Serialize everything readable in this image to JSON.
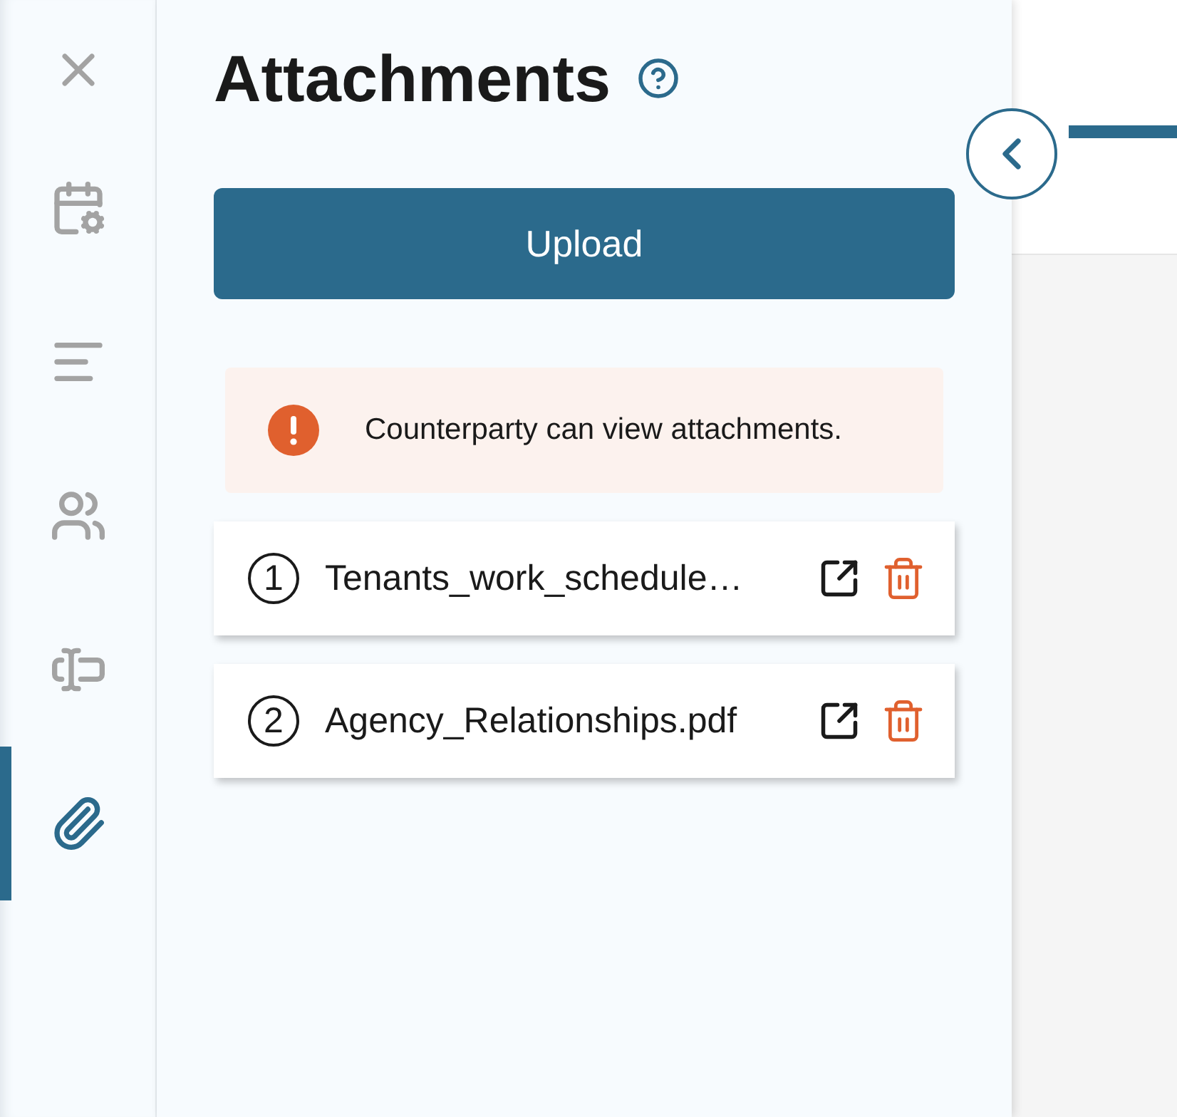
{
  "nav": [
    {
      "kind": "close",
      "selected": false
    },
    {
      "kind": "schedule",
      "selected": false
    },
    {
      "kind": "text",
      "selected": false
    },
    {
      "kind": "people",
      "selected": false
    },
    {
      "kind": "fields",
      "selected": false
    },
    {
      "kind": "attachments",
      "selected": true
    }
  ],
  "panel": {
    "title": "Attachments",
    "upload_button": "Upload",
    "notice": "Counterparty can view attachments.",
    "files": [
      {
        "number": "1",
        "name": "Tenants_work_schedule…"
      },
      {
        "number": "2",
        "name": "Agency_Relationships.pdf"
      }
    ]
  }
}
